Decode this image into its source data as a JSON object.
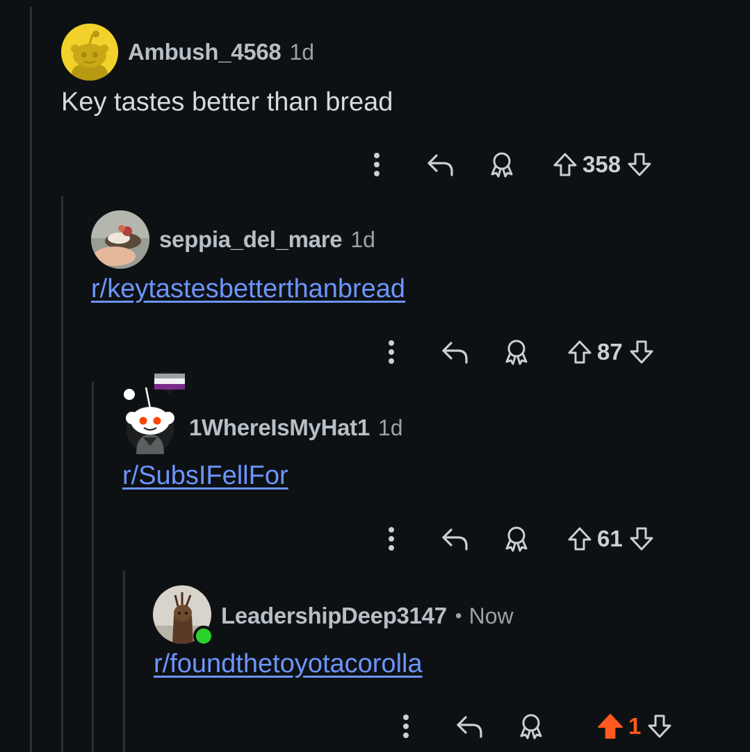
{
  "comments": [
    {
      "username": "Ambush_4568",
      "age": "1d",
      "body": "Key tastes better than bread",
      "is_link": false,
      "score": "358",
      "upvoted": false
    },
    {
      "username": "seppia_del_mare",
      "age": "1d",
      "body": "r/keytastesbetterthanbread",
      "is_link": true,
      "score": "87",
      "upvoted": false
    },
    {
      "username": "1WhereIsMyHat1",
      "age": "1d",
      "body": "r/SubsIFellFor",
      "is_link": true,
      "score": "61",
      "upvoted": false
    },
    {
      "username": "LeadershipDeep3147",
      "separator": "•",
      "age": "Now",
      "body": "r/foundthetoyotacorolla",
      "is_link": true,
      "score": "1",
      "upvoted": true,
      "online": true
    }
  ],
  "icons": {
    "more": "more-vertical-icon",
    "reply": "reply-arrow-icon",
    "award": "award-icon",
    "upvote": "upvote-arrow-icon",
    "downvote": "downvote-arrow-icon"
  },
  "colors": {
    "background": "#0e1113",
    "link": "#6c95ff",
    "upvoted": "#ff5a1f",
    "online": "#2bd12b",
    "default_avatar": "#f2d22a"
  }
}
